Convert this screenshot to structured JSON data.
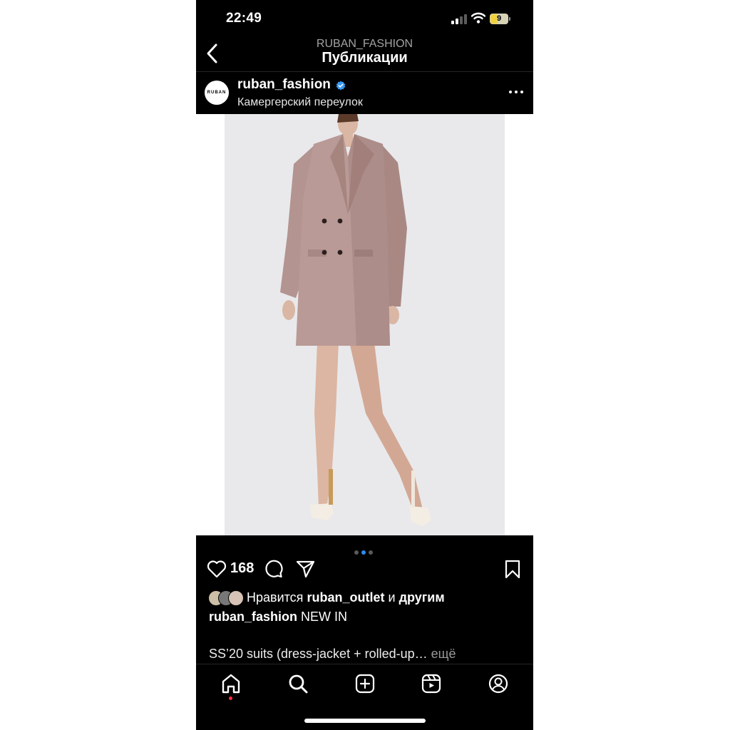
{
  "status_bar": {
    "time": "22:49",
    "battery_level": "9"
  },
  "header": {
    "subtitle": "RUBAN_FASHION",
    "title": "Публикации"
  },
  "post": {
    "username": "ruban_fashion",
    "location": "Камергерский переулок",
    "avatar_text": "RUBAN",
    "carousel": {
      "count": 3,
      "active_index": 1
    },
    "likes_count": "168",
    "likes_prefix": "Нравится",
    "likes_user": "ruban_outlet",
    "likes_join": "и",
    "likes_suffix": "другим",
    "caption_user": "ruban_fashion",
    "caption_text": "NEW IN",
    "caption_more_text": "SS’20 suits (dress-jacket + rolled-up…",
    "caption_more_link": "ещё"
  },
  "icons": {
    "back": "chevron-left-icon",
    "verified": "verified-badge-icon",
    "more": "more-horizontal-icon",
    "like": "heart-icon",
    "comment": "comment-icon",
    "share": "paper-plane-icon",
    "bookmark": "bookmark-icon",
    "home": "home-icon",
    "search": "search-icon",
    "create": "plus-square-icon",
    "reels": "reels-icon",
    "profile": "profile-icon"
  },
  "colors": {
    "background": "#000000",
    "verified": "#3897f0",
    "active_dot": "#2d8cf0",
    "notification_dot": "#ff3040",
    "jacket": "#b99a96"
  }
}
